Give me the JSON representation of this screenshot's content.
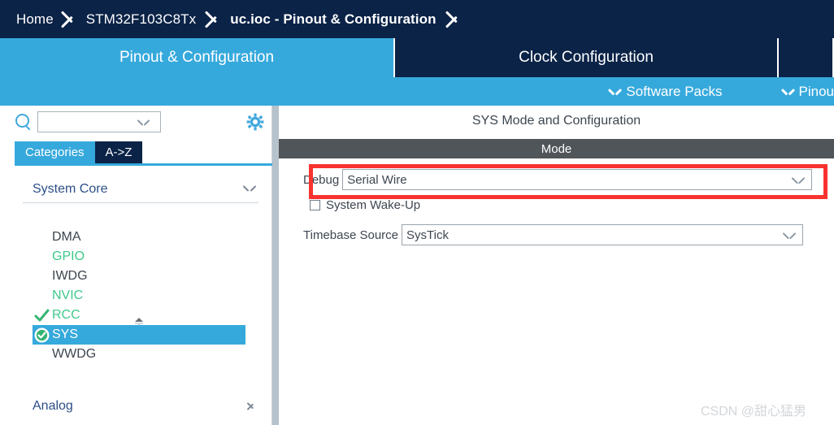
{
  "breadcrumb": {
    "items": [
      {
        "label": "Home",
        "bold": false
      },
      {
        "label": "STM32F103C8Tx",
        "bold": false
      },
      {
        "label": "uc.ioc - Pinout & Configuration",
        "bold": true
      }
    ]
  },
  "tabs": [
    {
      "label": "Pinout & Configuration",
      "active": true
    },
    {
      "label": "Clock Configuration",
      "active": false
    },
    {
      "label": "",
      "active": false
    }
  ],
  "submenu": [
    {
      "label": "Software Packs",
      "icon": "chevron-down-icon"
    },
    {
      "label": "Pinou",
      "icon": "chevron-down-icon"
    }
  ],
  "sidebar": {
    "search": {
      "value": "",
      "placeholder": ""
    },
    "search_icon": "search-icon",
    "settings_icon": "gear-icon",
    "cat_tabs": [
      {
        "label": "Categories",
        "active": true
      },
      {
        "label": "A->Z",
        "active": false
      }
    ],
    "groups": [
      {
        "label": "System Core",
        "expanded": true,
        "icon": "chevron-down-icon"
      },
      {
        "label": "Analog",
        "expanded": false,
        "icon": "chevron-right-icon"
      }
    ],
    "peripherals": [
      {
        "name": "DMA",
        "color": "#3d4650",
        "mark": "none",
        "selected": false
      },
      {
        "name": "GPIO",
        "color": "#3ec98a",
        "mark": "none",
        "selected": false
      },
      {
        "name": "IWDG",
        "color": "#3d4650",
        "mark": "none",
        "selected": false
      },
      {
        "name": "NVIC",
        "color": "#3ec98a",
        "mark": "none",
        "selected": false
      },
      {
        "name": "RCC",
        "color": "#3ec98a",
        "mark": "check",
        "selected": false
      },
      {
        "name": "SYS",
        "color": "#ffffff",
        "mark": "check-circle",
        "selected": true
      },
      {
        "name": "WWDG",
        "color": "#3d4650",
        "mark": "none",
        "selected": false
      }
    ]
  },
  "config": {
    "title": "SYS Mode and Configuration",
    "mode_header": "Mode",
    "debug": {
      "label": "Debug",
      "value": "Serial Wire"
    },
    "wakeup": {
      "label": "System Wake-Up",
      "checked": false
    },
    "timebase": {
      "label": "Timebase Source",
      "value": "SysTick"
    }
  },
  "annotation": {
    "color": "#f8332f"
  },
  "watermark": {
    "text": "CSDN @甜心猛男"
  },
  "colors": {
    "navy": "#0b2347",
    "accent_blue": "#36a9dc",
    "mode_gray": "#50555a",
    "green": "#3ec98a"
  }
}
